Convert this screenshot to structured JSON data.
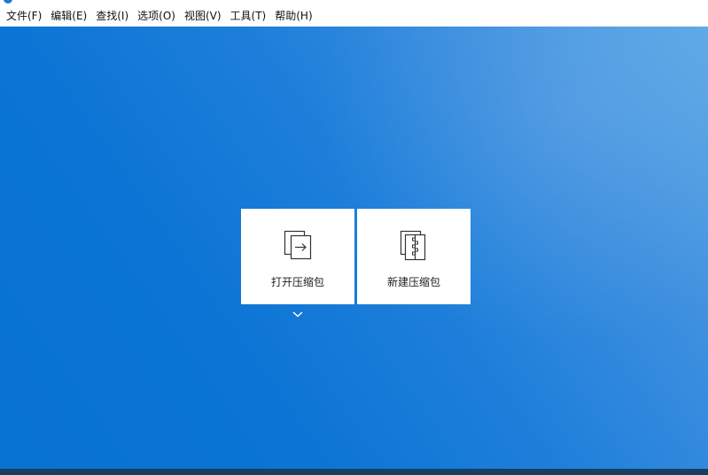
{
  "menu": {
    "items": [
      {
        "label": "文件(F)"
      },
      {
        "label": "编辑(E)"
      },
      {
        "label": "查找(I)"
      },
      {
        "label": "选项(O)"
      },
      {
        "label": "视图(V)"
      },
      {
        "label": "工具(T)"
      },
      {
        "label": "帮助(H)"
      }
    ]
  },
  "actions": {
    "open_archive": {
      "label": "打开压缩包",
      "icon": "open-archive-icon"
    },
    "new_archive": {
      "label": "新建压缩包",
      "icon": "zip-archive-icon"
    },
    "expand": {
      "icon": "chevron-down-icon"
    }
  },
  "colors": {
    "workspace_primary": "#0b74d4",
    "workspace_highlight": "#5ba7e6",
    "tile_background": "#ffffff",
    "statusbar": "#173f5f"
  }
}
